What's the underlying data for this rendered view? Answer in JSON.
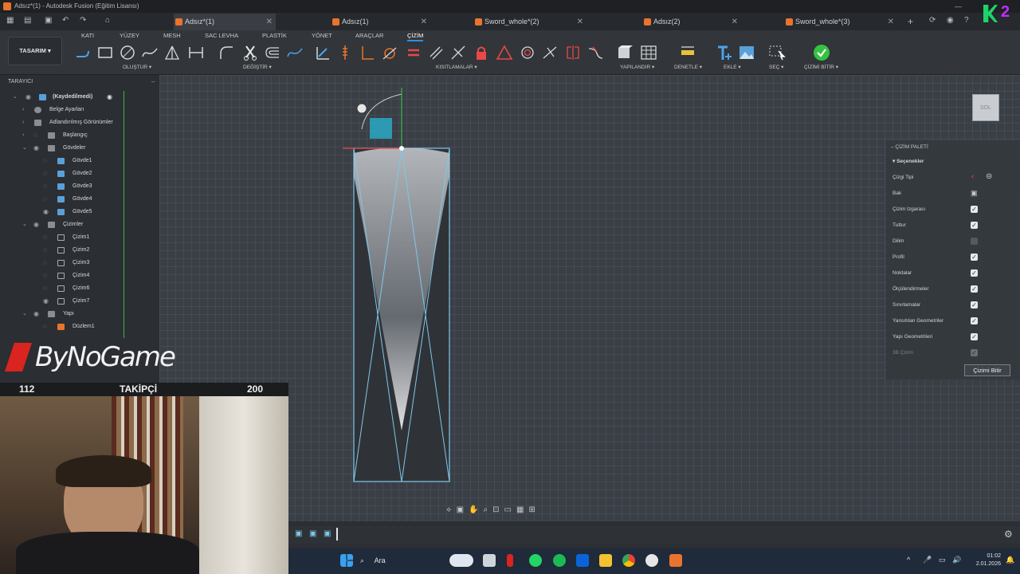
{
  "window": {
    "title": "Adsız*(1) - Autodesk Fusion (Eğitim Lisansı)"
  },
  "tabs": [
    {
      "label": "Adsız*(1)",
      "active": true
    },
    {
      "label": "Adsız(1)",
      "active": false
    },
    {
      "label": "Sword_whole*(2)",
      "active": false
    },
    {
      "label": "Adsız(2)",
      "active": false
    },
    {
      "label": "Sword_whole*(3)",
      "active": false
    }
  ],
  "badge_number": "2",
  "ribbon": {
    "workspace": "TASARIM",
    "tabs": [
      "KATI",
      "YÜZEY",
      "MESH",
      "SAC LEVHA",
      "PLASTİK",
      "YÖNET",
      "ARAÇLAR",
      "ÇİZİM"
    ],
    "active_tab": "ÇİZİM",
    "groups": {
      "create": "OLUŞTUR",
      "modify": "DEĞİŞTİR",
      "constraints": "KISITLAMALAR",
      "configure": "YAPILANDIR",
      "inspect": "DENETLE",
      "insert": "EKLE",
      "select": "SEÇ",
      "finish": "ÇİZİMİ BİTİR"
    }
  },
  "browser": {
    "header": "TARAYICI",
    "items": [
      {
        "label": "(Kaydedilmedi)",
        "level": 0
      },
      {
        "label": "Belge Ayarları",
        "level": 1
      },
      {
        "label": "Adlandırılmış Görünümler",
        "level": 1
      },
      {
        "label": "Başlangıç",
        "level": 1
      },
      {
        "label": "Gövdeler",
        "level": 1
      },
      {
        "label": "Gövde1",
        "level": 2
      },
      {
        "label": "Gövde2",
        "level": 2
      },
      {
        "label": "Gövde3",
        "level": 2
      },
      {
        "label": "Gövde4",
        "level": 2
      },
      {
        "label": "Gövde5",
        "level": 2
      },
      {
        "label": "Çizimler",
        "level": 1
      },
      {
        "label": "Çizim1",
        "level": 2
      },
      {
        "label": "Çizim2",
        "level": 2
      },
      {
        "label": "Çizim3",
        "level": 2
      },
      {
        "label": "Çizim4",
        "level": 2
      },
      {
        "label": "Çizim6",
        "level": 2
      },
      {
        "label": "Çizim7",
        "level": 2
      },
      {
        "label": "Yapı",
        "level": 1
      },
      {
        "label": "Düzlem1",
        "level": 2
      }
    ]
  },
  "viewcube_label": "SOL",
  "palette": {
    "title": "ÇİZİM PALETİ",
    "section": "Seçenekler",
    "options": [
      {
        "label": "Çizgi Tipi",
        "state": "icon"
      },
      {
        "label": "Bak",
        "state": "icon"
      },
      {
        "label": "Çizim Izgarası",
        "state": "on"
      },
      {
        "label": "Tuttur",
        "state": "on"
      },
      {
        "label": "Dilim",
        "state": "off"
      },
      {
        "label": "Profil",
        "state": "on"
      },
      {
        "label": "Noktalar",
        "state": "on"
      },
      {
        "label": "Ölçülendirmeler",
        "state": "on"
      },
      {
        "label": "Sınırlamalar",
        "state": "on"
      },
      {
        "label": "Yansıtılan Geometriler",
        "state": "on"
      },
      {
        "label": "Yapı Geometrileri",
        "state": "on"
      },
      {
        "label": "3B Çizim",
        "state": "dim"
      }
    ],
    "finish_button": "Çizimi Bitir"
  },
  "overlay": {
    "logo_text": "ByNoGame",
    "follow_current": "112",
    "follow_label": "TAKİPÇİ",
    "follow_goal": "200"
  },
  "taskbar": {
    "search_label": "Ara",
    "time": "01:02",
    "date": "2.01.2026"
  },
  "colors": {
    "accent": "#2e8fe3",
    "sketch_line": "#7fc8e8",
    "brand_orange": "#e8742d"
  }
}
